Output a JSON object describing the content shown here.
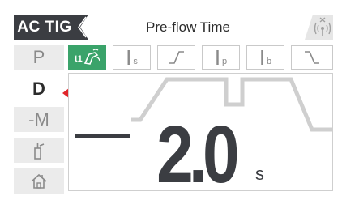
{
  "header": {
    "mode": "AC TIG",
    "title": "Pre-flow Time"
  },
  "sidebar": {
    "items": [
      {
        "label": "P",
        "active": false
      },
      {
        "label": "D",
        "active": true
      },
      {
        "label": "-M",
        "active": false
      },
      {
        "icon": "torch-icon",
        "active": false
      },
      {
        "icon": "home-icon",
        "active": false
      }
    ]
  },
  "tabs": [
    {
      "icon": "preflow-gas-icon",
      "active": true
    },
    {
      "symbol": "I",
      "sub": "s",
      "active": false
    },
    {
      "icon": "upslope-icon",
      "active": false
    },
    {
      "symbol": "I",
      "sub": "p",
      "active": false
    },
    {
      "symbol": "I",
      "sub": "b",
      "active": false
    },
    {
      "icon": "downslope-icon",
      "active": false
    }
  ],
  "display": {
    "value": "2.0",
    "unit": "s"
  },
  "colors": {
    "dark": "#3b3d42",
    "accent": "#3aa36a",
    "pointer": "#e0262b",
    "sidebar_bg": "#ebebeb",
    "wave": "#cfcfcf"
  }
}
